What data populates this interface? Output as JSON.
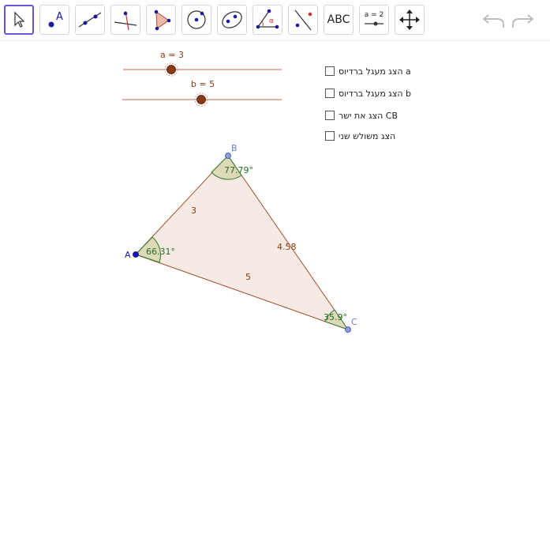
{
  "toolbar": {
    "tools": [
      {
        "name": "move-tool",
        "active": true
      },
      {
        "name": "point-tool",
        "label": "A"
      },
      {
        "name": "line-tool"
      },
      {
        "name": "perpendicular-line-tool"
      },
      {
        "name": "polygon-tool"
      },
      {
        "name": "circle-center-point-tool"
      },
      {
        "name": "ellipse-tool"
      },
      {
        "name": "angle-tool",
        "label": "α"
      },
      {
        "name": "reflect-tool"
      },
      {
        "name": "text-tool",
        "label": "ABC"
      },
      {
        "name": "slider-tool",
        "label": "a = 2"
      },
      {
        "name": "move-graphics-view-tool"
      }
    ],
    "undo": "undo",
    "redo": "redo"
  },
  "sliders": [
    {
      "label": "a = 3",
      "name": "a",
      "value": 3
    },
    {
      "label": "b = 5",
      "name": "b",
      "value": 5
    }
  ],
  "checkboxes": [
    {
      "label": "הצג מעגל ברדיוס a",
      "checked": false
    },
    {
      "label": "הצג מעגל ברדיוס b",
      "checked": false
    },
    {
      "label": "הצג את ישר CB",
      "checked": false
    },
    {
      "label": "הצג משולש שני",
      "checked": false
    }
  ],
  "triangle": {
    "points": {
      "A": "A",
      "B": "B",
      "C": "C"
    },
    "sides": {
      "AB": "3",
      "BC": "4.58",
      "AC": "5"
    },
    "angles": {
      "A": "66.31°",
      "B": "77.79°",
      "C": "35.9°"
    }
  },
  "colors": {
    "slider_line": "#d89a8a",
    "slider_knob": "#8b3a0f",
    "triangle_fill": "#f6e6e0",
    "triangle_stroke": "#a0522d",
    "angle_fill": "#d9d6b0",
    "angle_stroke": "#2b7a2b",
    "angle_text": "#1f6e1f",
    "side_text": "#8b3a0f",
    "point_A": "#1515c8",
    "point_B_C": "#6b7bd8",
    "toolbar_active": "#6557d2"
  }
}
